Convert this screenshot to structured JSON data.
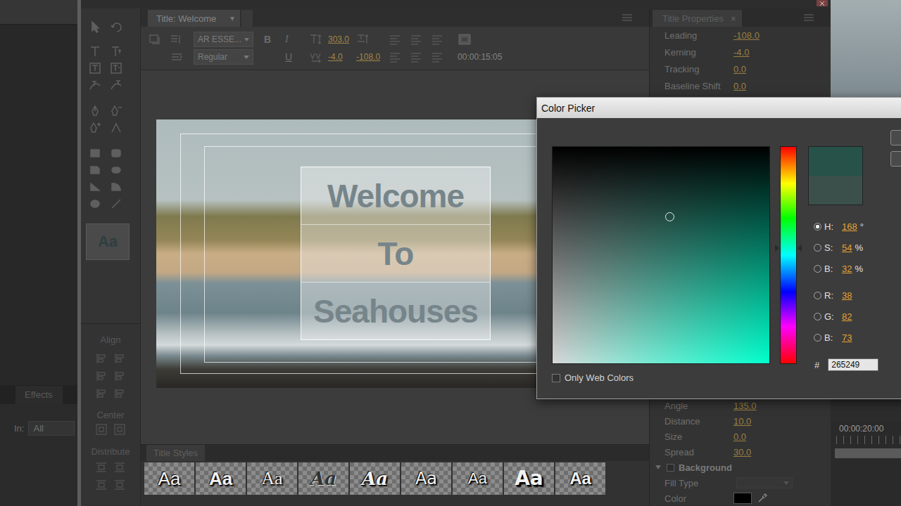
{
  "title_window": {
    "tab": "Title: Welcome",
    "tab_menu": "▾",
    "toolbar": {
      "font": "AR ESSE...",
      "style": "Regular",
      "bold": "B",
      "italic": "I",
      "underline": "U",
      "font_size": "303.0",
      "kerning": "-4.0",
      "leading": "-108.0",
      "timecode": "00:00:15:05"
    },
    "canvas": {
      "lines": [
        "Welcome",
        "To",
        "Seahouses"
      ]
    },
    "tool_preview": "Aa",
    "align_panel": {
      "align": "Align",
      "center": "Center",
      "distribute": "Distribute"
    },
    "properties": {
      "tab": "Title Properties",
      "close": "×",
      "top_rows": [
        {
          "label": "Leading",
          "value": "-108.0"
        },
        {
          "label": "Kerning",
          "value": "-4.0"
        },
        {
          "label": "Tracking",
          "value": "0.0"
        },
        {
          "label": "Baseline Shift",
          "value": "0.0"
        }
      ],
      "bottom_rows": [
        {
          "label": "Angle",
          "value": "135.0",
          "kind": "value"
        },
        {
          "label": "Distance",
          "value": "10.0",
          "kind": "value"
        },
        {
          "label": "Size",
          "value": "0.0",
          "kind": "value"
        },
        {
          "label": "Spread",
          "value": "30.0",
          "kind": "value"
        },
        {
          "label": "Background",
          "kind": "section",
          "expanded": true,
          "checked": false
        },
        {
          "label": "Fill Type",
          "kind": "dropdown",
          "disabled": true
        },
        {
          "label": "Color",
          "kind": "color",
          "color": "#000000"
        }
      ]
    },
    "styles": {
      "tab": "Title Styles",
      "swatches": [
        {
          "label": "Aa",
          "kind": "sans"
        },
        {
          "label": "Aa",
          "kind": "sans-bold"
        },
        {
          "label": "Aa",
          "kind": "serif"
        },
        {
          "label": "Aa",
          "kind": "script-dark"
        },
        {
          "label": "Aa",
          "kind": "script-light"
        },
        {
          "label": "Aa",
          "kind": "sans-light"
        },
        {
          "label": "Aa",
          "kind": "sans-thin"
        },
        {
          "label": "Aa",
          "kind": "heavy"
        },
        {
          "label": "Aa",
          "kind": "bold-shadow"
        }
      ]
    }
  },
  "effects_panel": {
    "tab": "Effects",
    "filter_label": "In:",
    "filter_value": "All"
  },
  "timeline": {
    "timecode": "00:00:20:00"
  },
  "color_picker": {
    "title": "Color Picker",
    "new_color": "#265249",
    "old_color": "#3b504b",
    "hue_level": 0.467,
    "saturation_level": 0.54,
    "brightness_level": 0.32,
    "channels": [
      {
        "label": "H:",
        "value": "168",
        "unit": "°",
        "selected": true,
        "group": 1
      },
      {
        "label": "S:",
        "value": "54",
        "unit": "%",
        "selected": false,
        "group": 1
      },
      {
        "label": "B:",
        "value": "32",
        "unit": "%",
        "selected": false,
        "group": 1
      },
      {
        "label": "R:",
        "value": "38",
        "selected": false,
        "group": 2
      },
      {
        "label": "G:",
        "value": "82",
        "selected": false,
        "group": 2
      },
      {
        "label": "B:",
        "value": "73",
        "selected": false,
        "group": 2
      }
    ],
    "hex_prefix": "#",
    "hex": "265249",
    "web_colors": {
      "label": "Only Web Colors",
      "checked": false
    }
  }
}
